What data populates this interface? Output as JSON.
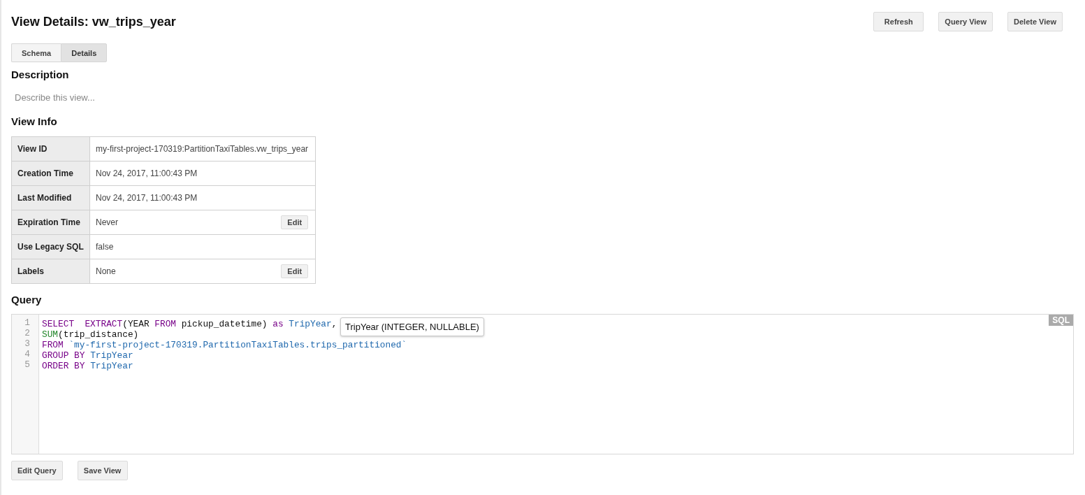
{
  "header": {
    "title": "View Details: vw_trips_year",
    "actions": [
      "Refresh",
      "Query View",
      "Delete View"
    ]
  },
  "tabs": [
    {
      "label": "Schema",
      "selected": false
    },
    {
      "label": "Details",
      "selected": true
    }
  ],
  "description": {
    "heading": "Description",
    "placeholder": "Describe this view..."
  },
  "view_info": {
    "heading": "View Info",
    "rows": [
      {
        "label": "View ID",
        "value": "my-first-project-170319:PartitionTaxiTables.vw_trips_year"
      },
      {
        "label": "Creation Time",
        "value": "Nov 24, 2017, 11:00:43 PM"
      },
      {
        "label": "Last Modified",
        "value": "Nov 24, 2017, 11:00:43 PM"
      },
      {
        "label": "Expiration Time",
        "value": "Never",
        "action": "Edit"
      },
      {
        "label": "Use Legacy SQL",
        "value": "false"
      },
      {
        "label": "Labels",
        "value": "None",
        "action": "Edit"
      }
    ]
  },
  "query": {
    "heading": "Query",
    "language_badge": "SQL",
    "tooltip": "TripYear (INTEGER, NULLABLE)",
    "lines": [
      {
        "number": "1",
        "tokens": [
          {
            "kind": "keyword",
            "text": "SELECT  EXTRACT"
          },
          {
            "kind": "plain",
            "text": "(YEAR "
          },
          {
            "kind": "keyword",
            "text": "FROM"
          },
          {
            "kind": "plain",
            "text": " pickup_datetime) "
          },
          {
            "kind": "keyword",
            "text": "as "
          },
          {
            "kind": "identifier",
            "text": "TripYear"
          },
          {
            "kind": "plain",
            "text": ","
          }
        ]
      },
      {
        "number": "2",
        "tokens": [
          {
            "kind": "function",
            "text": "SUM"
          },
          {
            "kind": "plain",
            "text": "(trip_distance)"
          }
        ]
      },
      {
        "number": "3",
        "tokens": [
          {
            "kind": "keyword",
            "text": "FROM "
          },
          {
            "kind": "identifier",
            "text": "`my-first-project-170319.PartitionTaxiTables.trips_partitioned`"
          }
        ]
      },
      {
        "number": "4",
        "tokens": [
          {
            "kind": "keyword",
            "text": "GROUP BY "
          },
          {
            "kind": "identifier",
            "text": "TripYear"
          }
        ]
      },
      {
        "number": "5",
        "tokens": [
          {
            "kind": "keyword",
            "text": "ORDER BY "
          },
          {
            "kind": "identifier",
            "text": "TripYear"
          }
        ]
      }
    ]
  },
  "footer_buttons": [
    "Edit Query",
    "Save View"
  ]
}
